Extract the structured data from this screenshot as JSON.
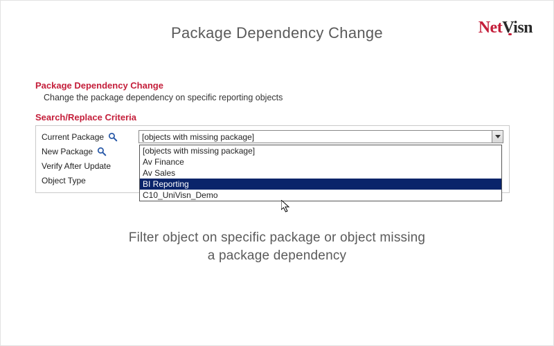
{
  "header": {
    "title": "Package Dependency Change"
  },
  "logo": {
    "part1": "Net",
    "part2": "Visn"
  },
  "section": {
    "title": "Package Dependency Change",
    "subtitle": "Change the package dependency on specific reporting objects"
  },
  "criteria": {
    "title": "Search/Replace Criteria",
    "labels": {
      "current_package": "Current Package",
      "new_package": "New Package",
      "verify_after_update": "Verify After Update",
      "object_type": "Object Type"
    },
    "current_package_select": {
      "value": "[objects with missing package]",
      "options": [
        "[objects with missing package]",
        "Av Finance",
        "Av Sales",
        "BI Reporting",
        "C10_UniVisn_Demo"
      ],
      "highlighted_index": 3
    }
  },
  "footer": {
    "line1": "Filter object on specific package or object missing",
    "line2": "a package dependency"
  }
}
